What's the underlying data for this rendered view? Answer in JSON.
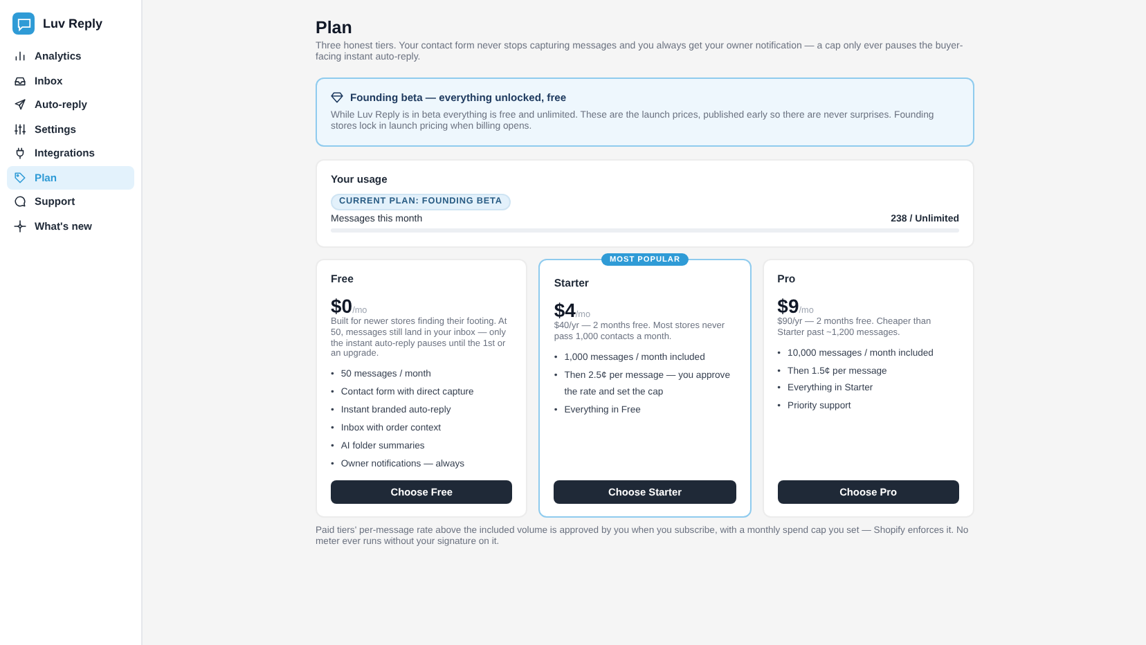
{
  "sidebar": {
    "brand": "Luv Reply",
    "items": [
      {
        "label": "Analytics",
        "selected": false
      },
      {
        "label": "Inbox",
        "selected": false
      },
      {
        "label": "Auto-reply",
        "selected": false
      },
      {
        "label": "Settings",
        "selected": false
      },
      {
        "label": "Integrations",
        "selected": false
      },
      {
        "label": "Plan",
        "selected": true
      },
      {
        "label": "Support",
        "selected": false
      },
      {
        "label": "What's new",
        "selected": false
      }
    ]
  },
  "page": {
    "title": "Plan",
    "subtitle": "Three honest tiers. Your contact form never stops capturing messages and you always get your owner notification — a cap only ever pauses the buyer-facing instant auto-reply."
  },
  "banner": {
    "title": "Founding beta — everything unlocked, free",
    "text": "While Luv Reply is in beta everything is free and unlimited. These are the launch prices, published early so there are never surprises. Founding stores lock in launch pricing when billing opens."
  },
  "usage": {
    "title": "Your usage",
    "badge": "CURRENT PLAN: FOUNDING BETA",
    "label": "Messages this month",
    "reading": "238 / Unlimited",
    "level": 0
  },
  "plans": [
    {
      "name": "Free",
      "bullet": "•",
      "price": "$0",
      "period": "/mo",
      "description": "Built for newer stores finding their footing. At 50, messages still land in your inbox — only the instant auto-reply pauses until the 1st or an upgrade.",
      "features": [
        "50 messages / month",
        "Contact form with direct capture",
        "Instant branded auto-reply",
        "Inbox with order context",
        "AI folder summaries",
        "Owner notifications — always"
      ],
      "button": "Choose Free",
      "featured": false
    },
    {
      "name": "Starter",
      "bullet": "•",
      "badge": "MOST POPULAR",
      "price": "$4",
      "period": "/mo",
      "description": "$40/yr — 2 months free. Most stores never pass 1,000 contacts a month.",
      "features": [
        "1,000 messages / month included",
        "Then 2.5¢ per message — you approve the rate and set the cap",
        "Everything in Free"
      ],
      "button": "Choose Starter",
      "featured": true
    },
    {
      "name": "Pro",
      "bullet": "•",
      "price": "$9",
      "period": "/mo",
      "description": "$90/yr — 2 months free. Cheaper than Starter past ~1,200 messages.",
      "features": [
        "10,000 messages / month included",
        "Then 1.5¢ per message",
        "Everything in Starter",
        "Priority support"
      ],
      "button": "Choose Pro",
      "featured": false
    }
  ],
  "footnote": "Paid tiers' per-message rate above the included volume is approved by you when you subscribe, with a monthly spend cap you set — Shopify enforces it. No meter ever runs without your signature on it."
}
